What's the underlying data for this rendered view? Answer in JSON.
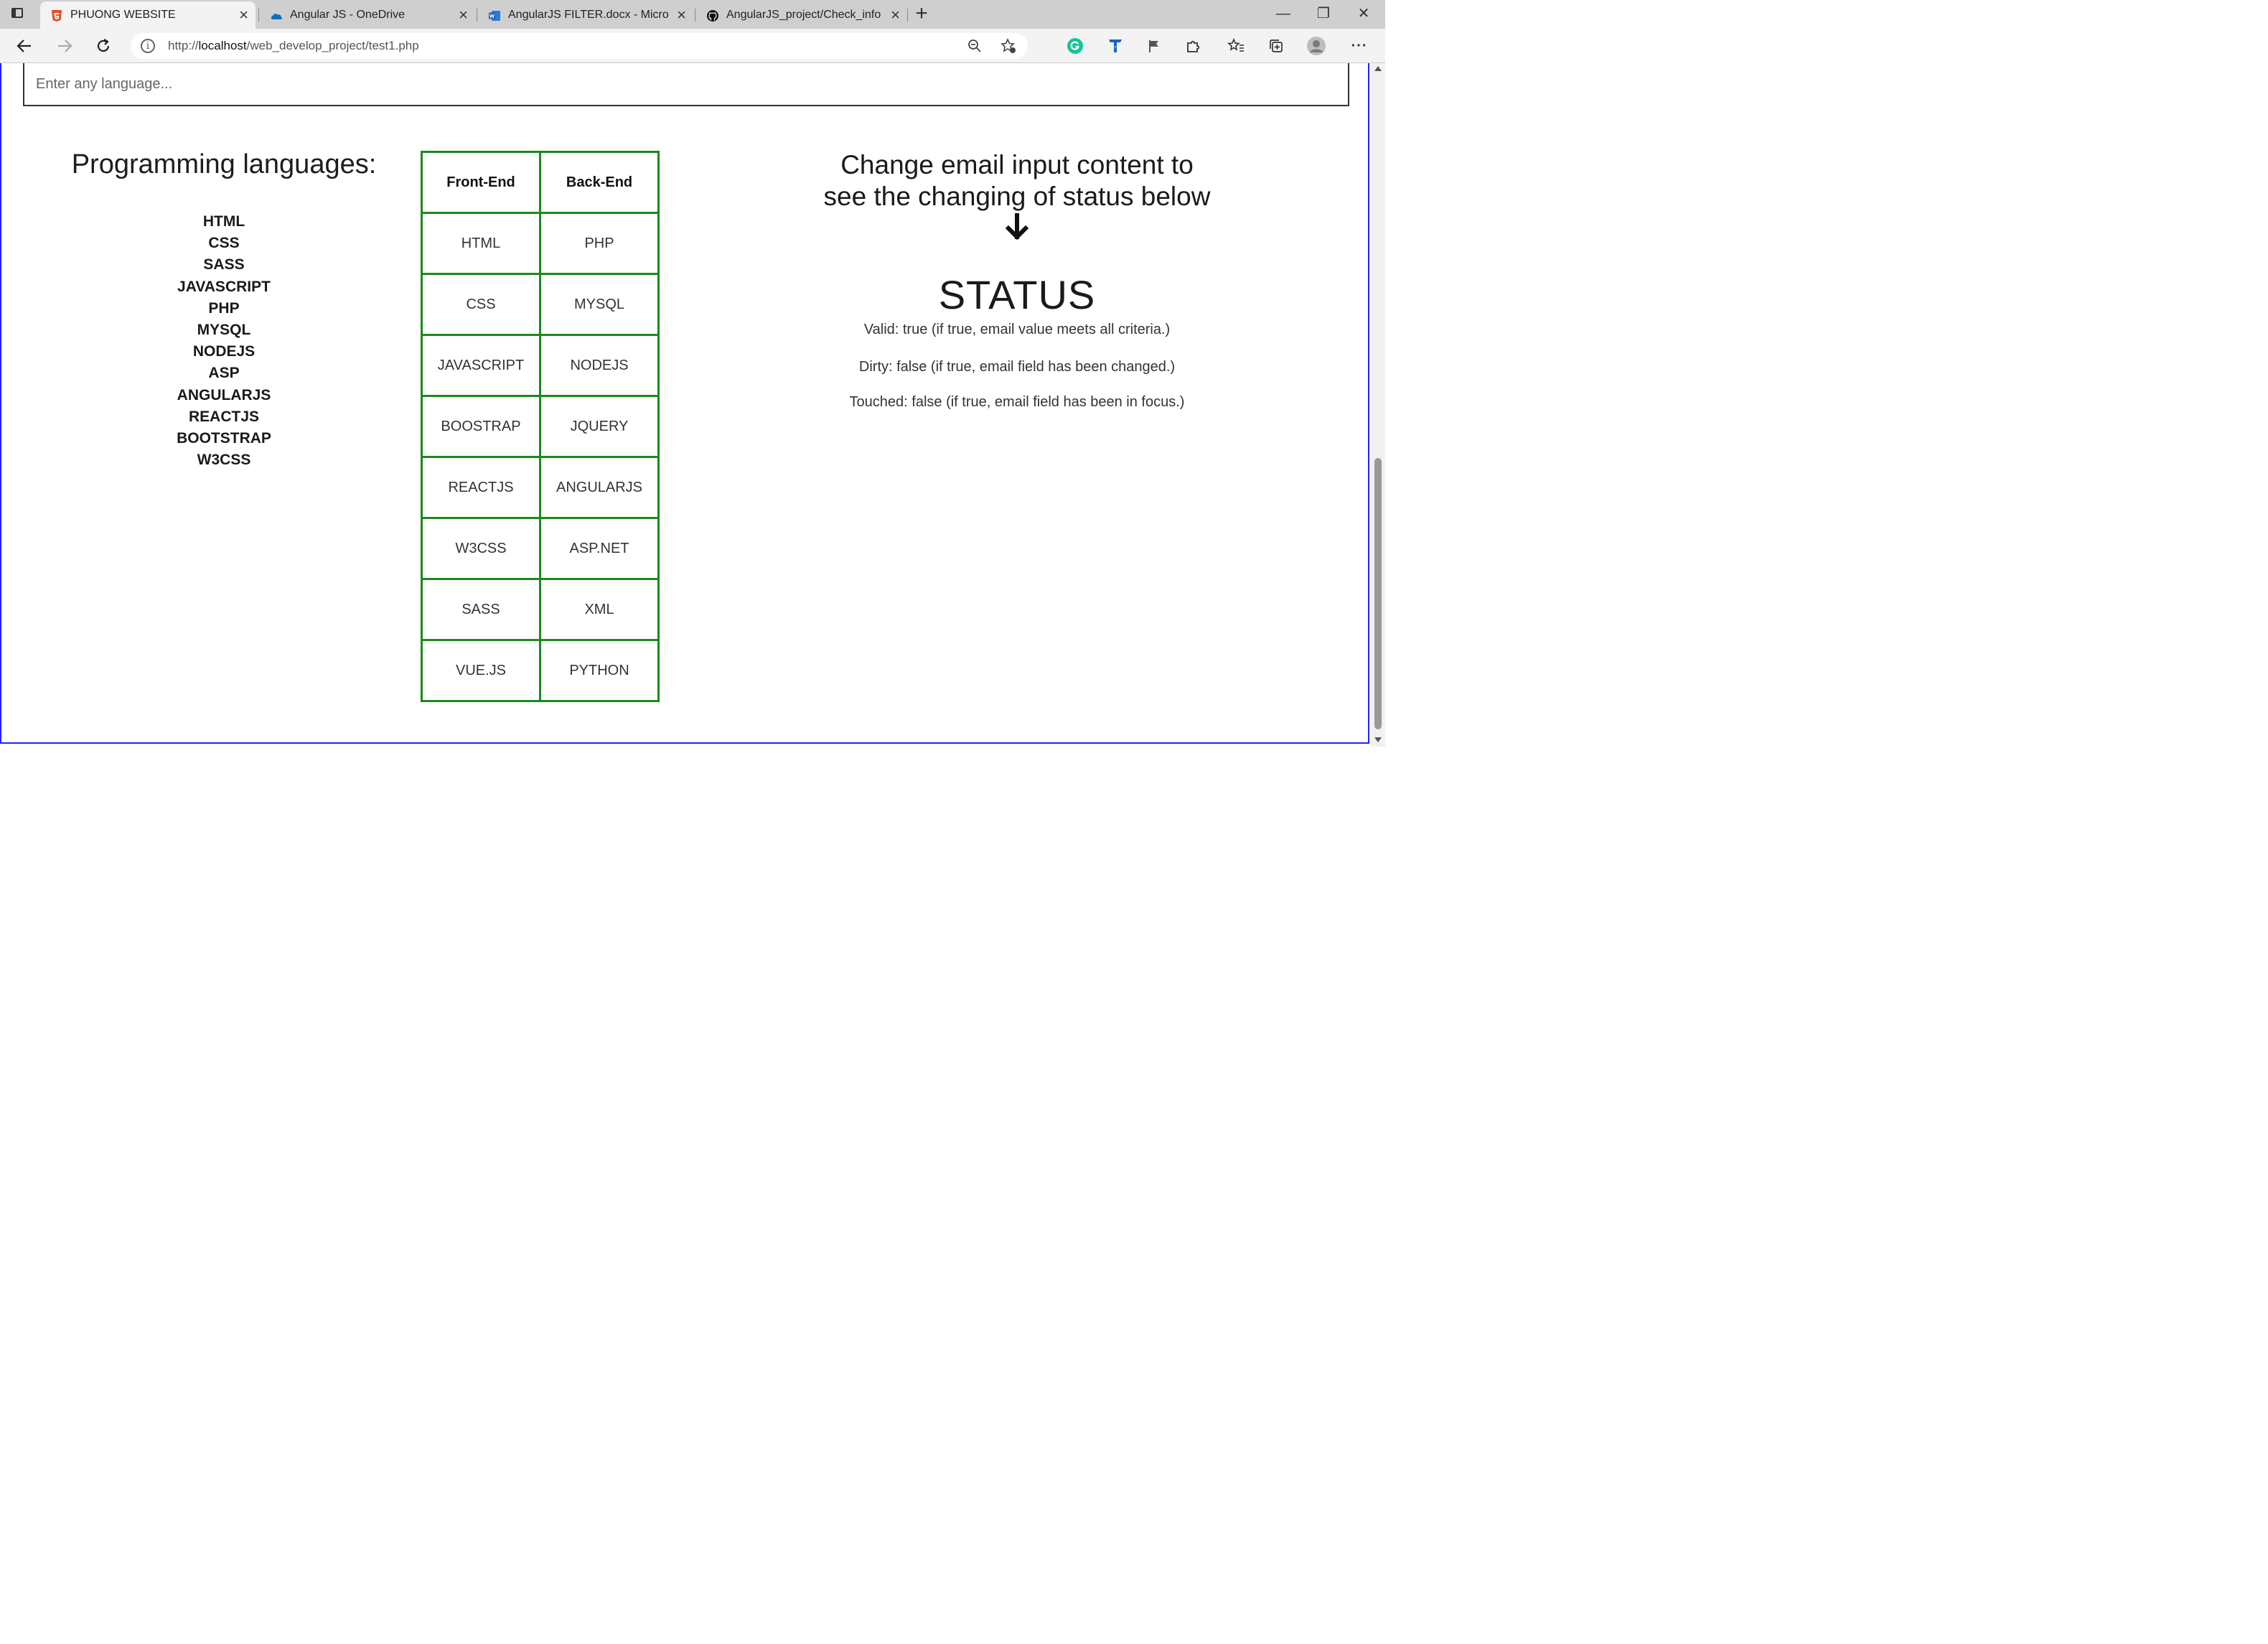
{
  "browser": {
    "tabs": [
      {
        "title": "PHUONG WEBSITE",
        "icon": "html5-icon",
        "active": true
      },
      {
        "title": "Angular JS - OneDrive",
        "icon": "onedrive-icon",
        "active": false
      },
      {
        "title": "AngularJS FILTER.docx - Microsoft",
        "icon": "word-icon",
        "active": false
      },
      {
        "title": "AngularJS_project/Check_info at",
        "icon": "github-icon",
        "active": false
      }
    ],
    "address": {
      "prefix": "http://",
      "host": "localhost",
      "path": "/web_develop_project/test1.php"
    }
  },
  "page": {
    "search_placeholder": "Enter any language...",
    "languages_heading": "Programming languages:",
    "languages": [
      "HTML",
      "CSS",
      "SASS",
      "JAVASCRIPT",
      "PHP",
      "MYSQL",
      "NODEJS",
      "ASP",
      "ANGULARJS",
      "REACTJS",
      "BOOTSTRAP",
      "W3CSS"
    ],
    "table": {
      "headers": [
        "Front-End",
        "Back-End"
      ],
      "rows": [
        [
          "HTML",
          "PHP"
        ],
        [
          "CSS",
          "MYSQL"
        ],
        [
          "JAVASCRIPT",
          "NODEJS"
        ],
        [
          "BOOSTRAP",
          "JQUERY"
        ],
        [
          "REACTJS",
          "ANGULARJS"
        ],
        [
          "W3CSS",
          "ASP.NET"
        ],
        [
          "SASS",
          "XML"
        ],
        [
          "VUE.JS",
          "PYTHON"
        ]
      ]
    },
    "hint_line1": "Change email input content to",
    "hint_line2": "see the changing of status below",
    "status_title": "STATUS",
    "status": {
      "valid": "Valid: true (if true, email value meets all criteria.)",
      "dirty": "Dirty: false (if true, email field has been changed.)",
      "touched": "Touched: false (if true, email field has been in focus.)"
    }
  },
  "colors": {
    "table_border": "#1a8a1a",
    "page_frame": "#2222ff",
    "grammarly": "#15c39a",
    "extension_blue": "#1565c0"
  }
}
